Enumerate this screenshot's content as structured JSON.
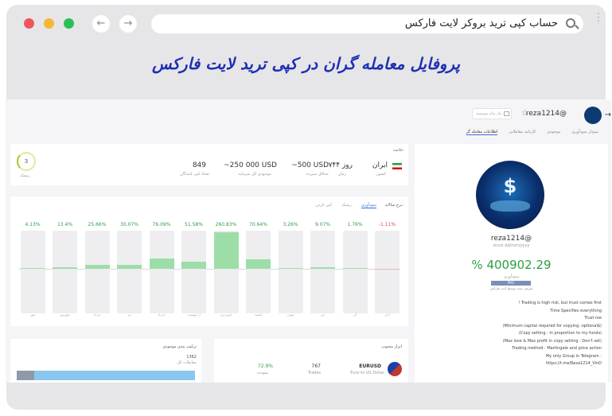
{
  "browser": {
    "address_text": "حساب کپی ترید بروکر لایت فارکس",
    "back_glyph": "←",
    "forward_glyph": "→",
    "menu_glyph": "⋮",
    "colors": {
      "close": "#f0555a",
      "minimize": "#f5b82f",
      "maximize": "#2bbf57"
    }
  },
  "headline": "پروفایل معامله گران در کپی ترید لایت فارکس",
  "profile_header": {
    "username": "reza1214@",
    "star_glyph": "☆",
    "message_placeholder": "یک پیام بنویسید",
    "tabs": [
      "اطلاعات معامله گر",
      "کارنامه معاملاتی",
      "موجودی",
      "نمودار سودآوری"
    ]
  },
  "summary": {
    "title": "خلاصه",
    "country": "ایران",
    "country_caption": "کشور",
    "days": "۷۴۴ روز",
    "days_caption": "زمان",
    "min_deposit": "~500 USD",
    "min_deposit_caption": "حداقل سپرده",
    "balance": "~250 000 USD",
    "balance_caption": "موجودی کل سرمایه",
    "copiers": "849",
    "copiers_caption": "تعداد کپی کنندگان",
    "risk": "3",
    "risk_caption": "ریسک"
  },
  "returns": {
    "title": "نرخ سالانه:",
    "tabs": [
      "سودآوری",
      "ریسک",
      "کپی کردن"
    ],
    "bars": [
      {
        "value": -1.11,
        "label": "-1.11%",
        "month": "آبان"
      },
      {
        "value": 1.76,
        "label": "1.76%",
        "month": "آذر"
      },
      {
        "value": 9.07,
        "label": "9.07%",
        "month": "دی"
      },
      {
        "value": 3.26,
        "label": "3.26%",
        "month": "بهمن"
      },
      {
        "value": 70.64,
        "label": "70.64%",
        "month": "اسفند"
      },
      {
        "value": 260.83,
        "label": "260.83%",
        "month": "فروردین"
      },
      {
        "value": 51.58,
        "label": "51.58%",
        "month": "اردیبهشت"
      },
      {
        "value": 76.09,
        "label": "76.09%",
        "month": "خرداد"
      },
      {
        "value": 30.07,
        "label": "30.07%",
        "month": "تیر"
      },
      {
        "value": 25.66,
        "label": "25.66%",
        "month": "مرداد"
      },
      {
        "value": 13.4,
        "label": "13.4%",
        "month": "شهریور"
      },
      {
        "value": 4.13,
        "label": "4.13%",
        "month": "مهر"
      }
    ],
    "max_value": 260.83,
    "positive_color": "#2e9e44",
    "negative_color": "#e04848"
  },
  "instruments": {
    "title": "ابزار محبوب",
    "symbol": "EURUSD",
    "symbol_caption": "Euro to US Dollar",
    "trades": "767",
    "trades_caption": "Trades",
    "profitable": "72.9%",
    "profitable_caption": "سودده"
  },
  "composition": {
    "title": "ترکیب بندی موجودی",
    "value": "1362",
    "caption": "معاملات کل",
    "share": 0.9
  },
  "profile_card": {
    "username": "reza1214@",
    "since": "since dd/mm/yyyy",
    "gain": "% 400902.29",
    "gain_caption": "سودآوری",
    "badge": "PRO",
    "badge_caption": "معرفی شده توسط لایت فارکس",
    "bio": [
      "! Trading is high risk, but trust comes first",
      "Time Specifies everything",
      "Trust me",
      "(Minimum capital required for copying: optional$)",
      "(Copy setting : in proportion to my funds)",
      "(Max lose & Max profit in copy setting : Don't set)",
      "Trading method : Martingale and price action",
      "My only Group in Telegram :",
      "https://t.me/Reza1214_VinD"
    ]
  }
}
